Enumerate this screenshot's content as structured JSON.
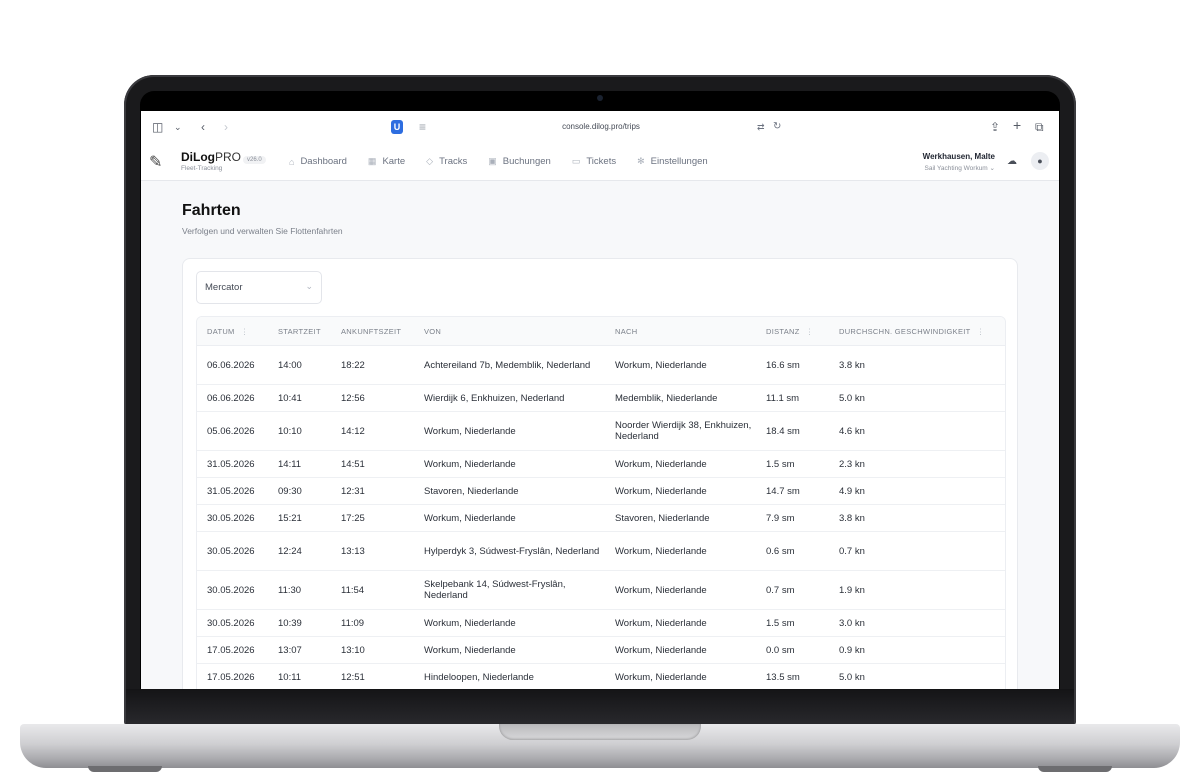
{
  "browser": {
    "url": "console.dilog.pro/trips"
  },
  "app": {
    "brand_bold": "DiLog",
    "brand_light": "PRO",
    "brand_sub": "Fleet-Tracking",
    "version": "v26.0",
    "nav": [
      {
        "label": "Dashboard",
        "icon": "home-icon"
      },
      {
        "label": "Karte",
        "icon": "map-icon"
      },
      {
        "label": "Tracks",
        "icon": "route-icon"
      },
      {
        "label": "Buchungen",
        "icon": "calendar-icon"
      },
      {
        "label": "Tickets",
        "icon": "ticket-icon"
      },
      {
        "label": "Einstellungen",
        "icon": "gear-icon"
      }
    ],
    "user": {
      "name": "Werkhausen, Malte",
      "org": "Sail Yachting Workum"
    }
  },
  "page": {
    "title": "Fahrten",
    "subtitle": "Verfolgen und verwalten Sie Flottenfahrten"
  },
  "filter": {
    "selected": "Mercator"
  },
  "table": {
    "columns": [
      "DATUM",
      "STARTZEIT",
      "ANKUNFTSZEIT",
      "VON",
      "NACH",
      "DISTANZ",
      "DURCHSCHN. GESCHWINDIGKEIT"
    ],
    "rows": [
      [
        "06.06.2026",
        "14:00",
        "18:22",
        "Achtereiland 7b, Medemblik, Nederland",
        "Workum, Niederlande",
        "16.6 sm",
        "3.8 kn"
      ],
      [
        "06.06.2026",
        "10:41",
        "12:56",
        "Wierdijk 6, Enkhuizen, Nederland",
        "Medemblik, Niederlande",
        "11.1 sm",
        "5.0 kn"
      ],
      [
        "05.06.2026",
        "10:10",
        "14:12",
        "Workum, Niederlande",
        "Noorder Wierdijk 38, Enkhuizen, Nederland",
        "18.4 sm",
        "4.6 kn"
      ],
      [
        "31.05.2026",
        "14:11",
        "14:51",
        "Workum, Niederlande",
        "Workum, Niederlande",
        "1.5 sm",
        "2.3 kn"
      ],
      [
        "31.05.2026",
        "09:30",
        "12:31",
        "Stavoren, Niederlande",
        "Workum, Niederlande",
        "14.7 sm",
        "4.9 kn"
      ],
      [
        "30.05.2026",
        "15:21",
        "17:25",
        "Workum, Niederlande",
        "Stavoren, Niederlande",
        "7.9 sm",
        "3.8 kn"
      ],
      [
        "30.05.2026",
        "12:24",
        "13:13",
        "Hylperdyk 3, Súdwest-Fryslân, Nederland",
        "Workum, Niederlande",
        "0.6 sm",
        "0.7 kn"
      ],
      [
        "30.05.2026",
        "11:30",
        "11:54",
        "Skelpebank 14, Súdwest-Fryslân, Nederland",
        "Workum, Niederlande",
        "0.7 sm",
        "1.9 kn"
      ],
      [
        "30.05.2026",
        "10:39",
        "11:09",
        "Workum, Niederlande",
        "Workum, Niederlande",
        "1.5 sm",
        "3.0 kn"
      ],
      [
        "17.05.2026",
        "13:07",
        "13:10",
        "Workum, Niederlande",
        "Workum, Niederlande",
        "0.0 sm",
        "0.9 kn"
      ],
      [
        "17.05.2026",
        "10:11",
        "12:51",
        "Hindeloopen, Niederlande",
        "Workum, Niederlande",
        "13.5 sm",
        "5.0 kn"
      ]
    ]
  }
}
